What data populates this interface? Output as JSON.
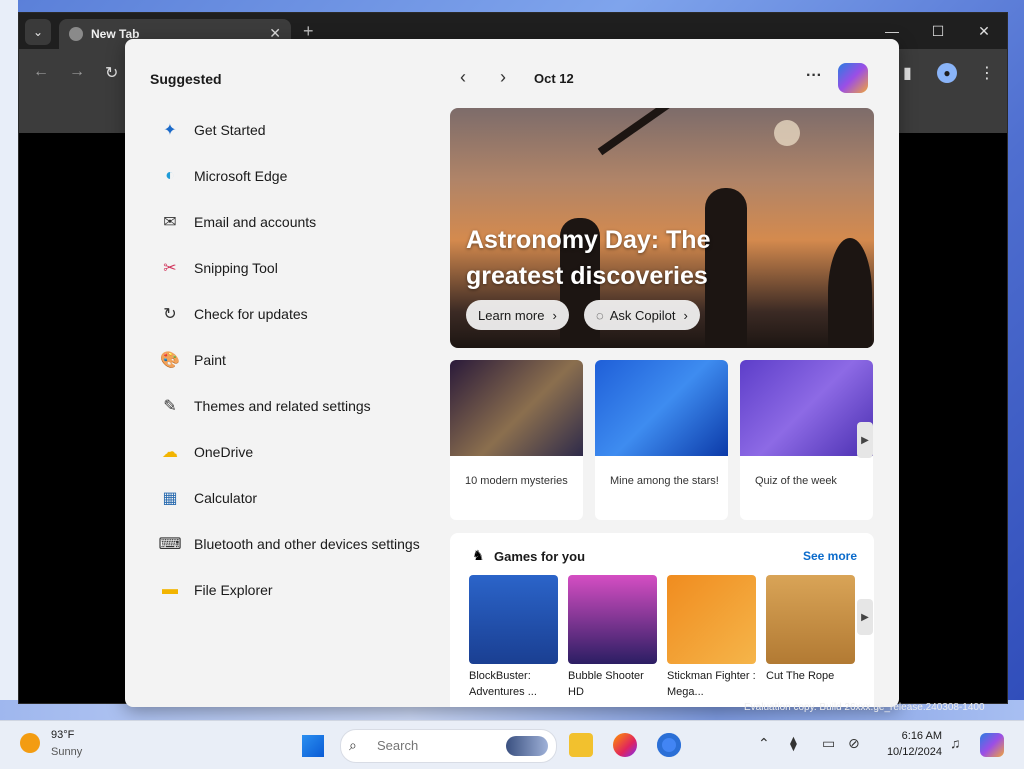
{
  "browser": {
    "tab_title": "New Tab"
  },
  "panel": {
    "suggested_title": "Suggested",
    "suggested_items": [
      {
        "label": "Get Started",
        "icon": "get-started-icon",
        "glyph": "✦",
        "color": "#1b6ac9"
      },
      {
        "label": "Microsoft Edge",
        "icon": "edge-icon",
        "glyph": "◐",
        "color": "#1e9bd7"
      },
      {
        "label": "Email and accounts",
        "icon": "mail-icon",
        "glyph": "✉",
        "color": "#333333"
      },
      {
        "label": "Snipping Tool",
        "icon": "snipping-tool-icon",
        "glyph": "✂",
        "color": "#d1345b"
      },
      {
        "label": "Check for updates",
        "icon": "refresh-icon",
        "glyph": "↻",
        "color": "#333333"
      },
      {
        "label": "Paint",
        "icon": "paint-icon",
        "glyph": "🎨",
        "color": "#2d9cdb"
      },
      {
        "label": "Themes and related settings",
        "icon": "brush-icon",
        "glyph": "✎",
        "color": "#333333"
      },
      {
        "label": "OneDrive",
        "icon": "onedrive-icon",
        "glyph": "☁",
        "color": "#f2b400"
      },
      {
        "label": "Calculator",
        "icon": "calculator-icon",
        "glyph": "▦",
        "color": "#2b6cb0"
      },
      {
        "label": "Bluetooth and other devices settings",
        "icon": "devices-icon",
        "glyph": "⌨",
        "color": "#333333"
      },
      {
        "label": "File Explorer",
        "icon": "folder-icon",
        "glyph": "▬",
        "color": "#f2b400"
      }
    ],
    "date": "Oct 12",
    "hero": {
      "title": "Astronomy Day: The greatest discoveries",
      "learn_more": "Learn more",
      "ask_copilot": "Ask Copilot"
    },
    "cards": [
      {
        "caption": "10 modern mysteries",
        "bg": "linear-gradient(135deg,#2a1a3a,#8b6f4e 55%,#2e2a4a)"
      },
      {
        "caption": "Mine among the stars!",
        "bg": "linear-gradient(135deg,#1f5fd8,#3e8cf0 50%,#0c3aa8)"
      },
      {
        "caption": "Quiz of the week",
        "bg": "linear-gradient(135deg,#5d3ec9,#8d6ae5 50%,#4a2fb0)"
      }
    ],
    "games": {
      "title": "Games for you",
      "see_more": "See more",
      "items": [
        {
          "name": "BlockBuster: Adventures ...",
          "bg": "linear-gradient(180deg,#2b64c9,#1a3f92)"
        },
        {
          "name": "Bubble Shooter HD",
          "bg": "linear-gradient(180deg,#d54ec3,#2b1e63)"
        },
        {
          "name": "Stickman Fighter : Mega...",
          "bg": "linear-gradient(135deg,#f08c1f,#f5b54a)"
        },
        {
          "name": "Cut The Rope",
          "bg": "linear-gradient(180deg,#d9a457,#b27a33)"
        }
      ]
    }
  },
  "taskbar": {
    "temperature": "93°F",
    "condition": "Sunny",
    "search_placeholder": "Search",
    "time": "6:16 AM",
    "date": "10/12/2024"
  },
  "watermark": "Evaluation copy. Build 26xxx.ge_release.240308-1400"
}
